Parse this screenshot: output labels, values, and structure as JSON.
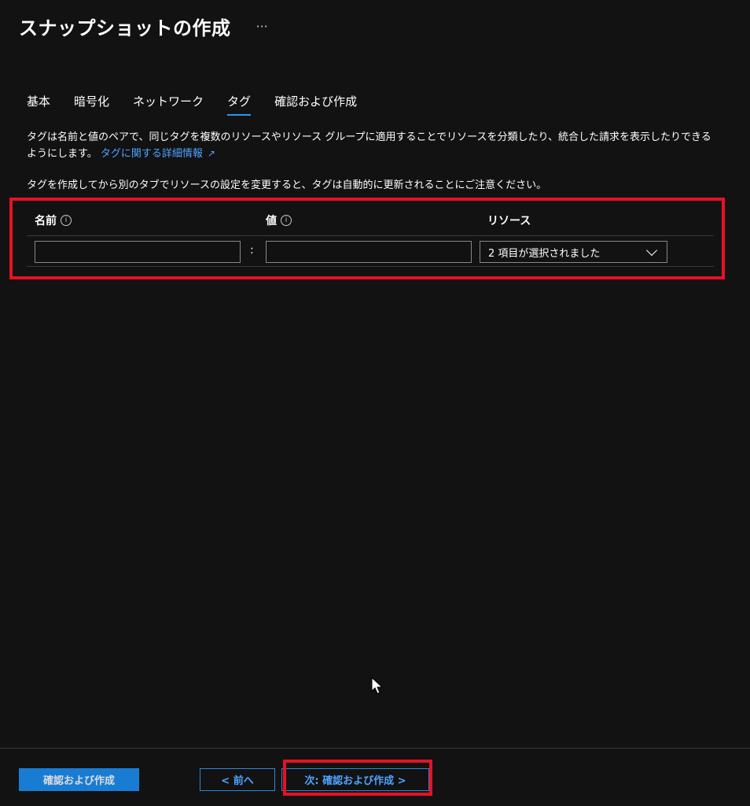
{
  "header": {
    "title": "スナップショットの作成",
    "more_label": "···"
  },
  "tabs": [
    {
      "label": "基本"
    },
    {
      "label": "暗号化"
    },
    {
      "label": "ネットワーク"
    },
    {
      "label": "タグ",
      "active": true
    },
    {
      "label": "確認および作成"
    }
  ],
  "description": {
    "text": "タグは名前と値のペアで、同じタグを複数のリソースやリソース グループに適用することでリソースを分類したり、統合した請求を表示したりできるようにします。",
    "link": "タグに関する詳細情報"
  },
  "note": "タグを作成してから別のタブでリソースの設定を変更すると、タグは自動的に更新されることにご注意ください。",
  "grid": {
    "col_name": "名前",
    "col_value": "値",
    "col_resource": "リソース",
    "row": {
      "name_value": "",
      "value_value": "",
      "separator": ":",
      "resource_selected": "2 項目が選択されました"
    }
  },
  "footer": {
    "review_create": "確認および作成",
    "previous": "< 前へ",
    "next": "次: 確認および作成 >"
  },
  "colors": {
    "accent": "#2899f5",
    "highlight": "#e81123",
    "background": "#121213"
  }
}
